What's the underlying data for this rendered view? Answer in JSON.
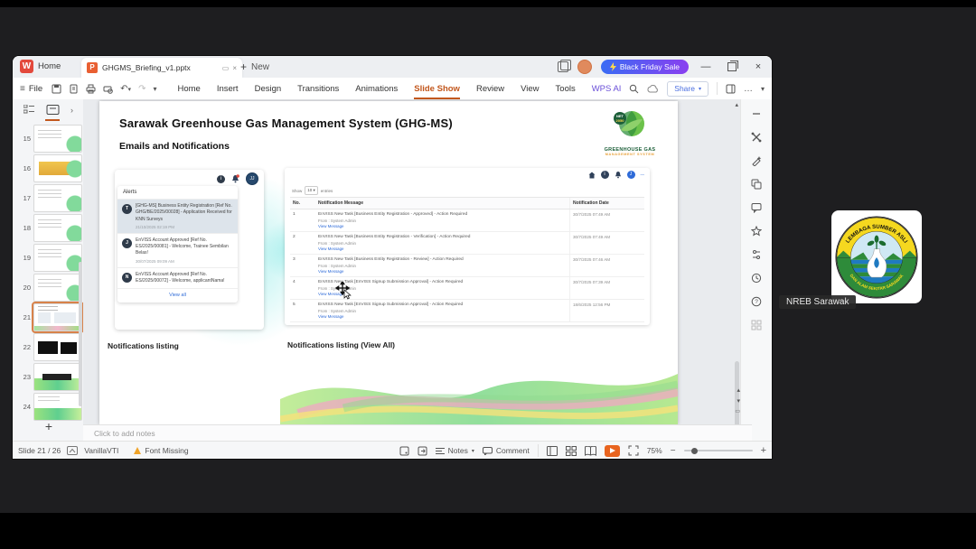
{
  "titlebar": {
    "home_tab": "Home",
    "doc_title": "GHGMS_Briefing_v1.pptx",
    "new_label": "New",
    "promo_label": "Black Friday Sale"
  },
  "menubar": {
    "file_label": "File",
    "menus": [
      "Home",
      "Insert",
      "Design",
      "Transitions",
      "Animations",
      "Slide Show",
      "Review",
      "View",
      "Tools",
      "WPS AI"
    ],
    "active_menu": "Slide Show",
    "share_label": "Share"
  },
  "slide_panel": {
    "slides": [
      {
        "num": "15"
      },
      {
        "num": "16"
      },
      {
        "num": "17"
      },
      {
        "num": "18"
      },
      {
        "num": "19"
      },
      {
        "num": "20"
      },
      {
        "num": "21"
      },
      {
        "num": "22"
      },
      {
        "num": "23"
      },
      {
        "num": "24"
      }
    ],
    "selected": "21",
    "add_label": "+"
  },
  "slide": {
    "title": "Sarawak Greenhouse Gas Management System (GHG-MS)",
    "subtitle": "Emails and Notifications",
    "logo": {
      "badge_line1": "NET",
      "badge_line2": "2050",
      "line1": "GREENHOUSE GAS",
      "line2": "MANAGEMENT SYSTEM"
    },
    "captions": {
      "left": "Notifications listing",
      "right": "Notifications listing (View All)"
    },
    "alerts_panel": {
      "header": "Alerts",
      "items": [
        {
          "avatar": "T",
          "text": "[GHG-MS] Business Entity Registration [Ref No. GHG/BE/2025/00028] - Application Received for KNN Surveys",
          "time": "21/10/2025 02:19 PM"
        },
        {
          "avatar": "J",
          "text": "EnVISS Account Approved [Ref No. ES/2025/00081] - Welcome, Trainee Sembilan Belas!",
          "time": "30/07/2025 09:09 AM"
        },
        {
          "avatar": "N",
          "text": "EnVISS Account Approved [Ref No. ES/2025/00072] - Welcome, applicantNama!",
          "time": ""
        }
      ],
      "view_all": "View all"
    },
    "table_panel": {
      "show_label": "Show",
      "show_value": "10",
      "entries_label": "entries",
      "columns": [
        "No.",
        "Notification Message",
        "Notification Date"
      ],
      "from_line": "From : System Admin",
      "link_label": "View Message",
      "rows": [
        {
          "no": "1",
          "message": "EnVISS New Task [Business Entity Registration - Approved] - Action Required",
          "date": "30/7/2025 07:49 AM"
        },
        {
          "no": "2",
          "message": "EnVISS New Task [Business Entity Registration - Verification] - Action Required",
          "date": "30/7/2025 07:49 AM"
        },
        {
          "no": "3",
          "message": "EnVISS New Task [Business Entity Registration - Review] - Action Required",
          "date": "30/7/2025 07:46 AM"
        },
        {
          "no": "4",
          "message": "EnVISS New Task [EnVISS Signup Submission Approval] - Action Required",
          "date": "30/7/2025 07:39 AM"
        },
        {
          "no": "5",
          "message": "EnVISS New Task [EnVISS Signup Submission Approval] - Action Required",
          "date": "18/6/2025 12:56 PM"
        }
      ]
    }
  },
  "notes": {
    "placeholder": "Click to add notes"
  },
  "statusbar": {
    "slide_indicator": "Slide 21 / 26",
    "theme_name": "VanillaVTI",
    "font_missing": "Font Missing",
    "notes_label": "Notes",
    "comment_label": "Comment",
    "zoom_level": "75%"
  },
  "participant": {
    "name": "NREB Sarawak",
    "emblem_top": "LEMBAGA SUMBER ASLI",
    "emblem_bottom": "DAN ALAM SEKITAR SARAWAK"
  },
  "colors": {
    "accent_orange": "#c2571d",
    "promo_start": "#3a6cf4",
    "promo_end": "#8a3ff0",
    "link_blue": "#2e6bd8",
    "highlight_row": "#dde4eb",
    "logo_green": "#1b5e38",
    "logo_orange": "#e8a13a",
    "play_orange": "#e8641f"
  }
}
